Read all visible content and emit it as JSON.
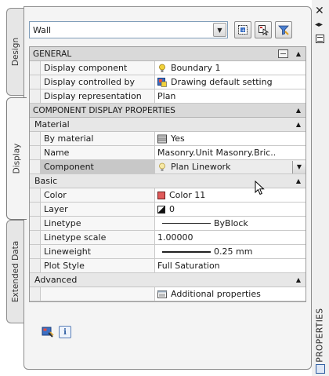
{
  "palette": {
    "title": "PROPERTIES",
    "tabs": [
      {
        "label": "Design",
        "active": false
      },
      {
        "label": "Display",
        "active": true
      },
      {
        "label": "Extended Data",
        "active": false
      }
    ]
  },
  "stylebar": {
    "selected": "Wall"
  },
  "general": {
    "title": "GENERAL",
    "rows": [
      {
        "name": "Display component",
        "value": "Boundary 1",
        "icon": "lightbulb-icon"
      },
      {
        "name": "Display controlled by",
        "value": "Drawing default setting",
        "icon": "drawing-default-icon"
      },
      {
        "name": "Display representation",
        "value": "Plan",
        "icon": ""
      }
    ]
  },
  "component": {
    "title": "COMPONENT DISPLAY PROPERTIES",
    "material": {
      "title": "Material",
      "rows": [
        {
          "name": "By material",
          "value": "Yes",
          "icon": "material-icon"
        },
        {
          "name": "Name",
          "value": "Masonry.Unit Masonry.Bric..",
          "icon": ""
        },
        {
          "name": "Component",
          "value": "Plan Linework",
          "icon": "lightbulb-icon"
        }
      ]
    },
    "basic": {
      "title": "Basic",
      "rows": [
        {
          "name": "Color",
          "value": "Color 11",
          "icon": "color-swatch-icon",
          "color": "#e05a5a"
        },
        {
          "name": "Layer",
          "value": "0",
          "icon": "layer-icon"
        },
        {
          "name": "Linetype",
          "value": "ByBlock",
          "icon": "linetype-icon"
        },
        {
          "name": "Linetype scale",
          "value": "1.00000",
          "icon": ""
        },
        {
          "name": "Lineweight",
          "value": "0.25 mm",
          "icon": "lineweight-icon"
        },
        {
          "name": "Plot Style",
          "value": "Full Saturation",
          "icon": ""
        }
      ]
    },
    "advanced": {
      "title": "Advanced",
      "rows": [
        {
          "name": "",
          "value": "Additional properties",
          "icon": "worksheet-icon"
        }
      ]
    }
  }
}
